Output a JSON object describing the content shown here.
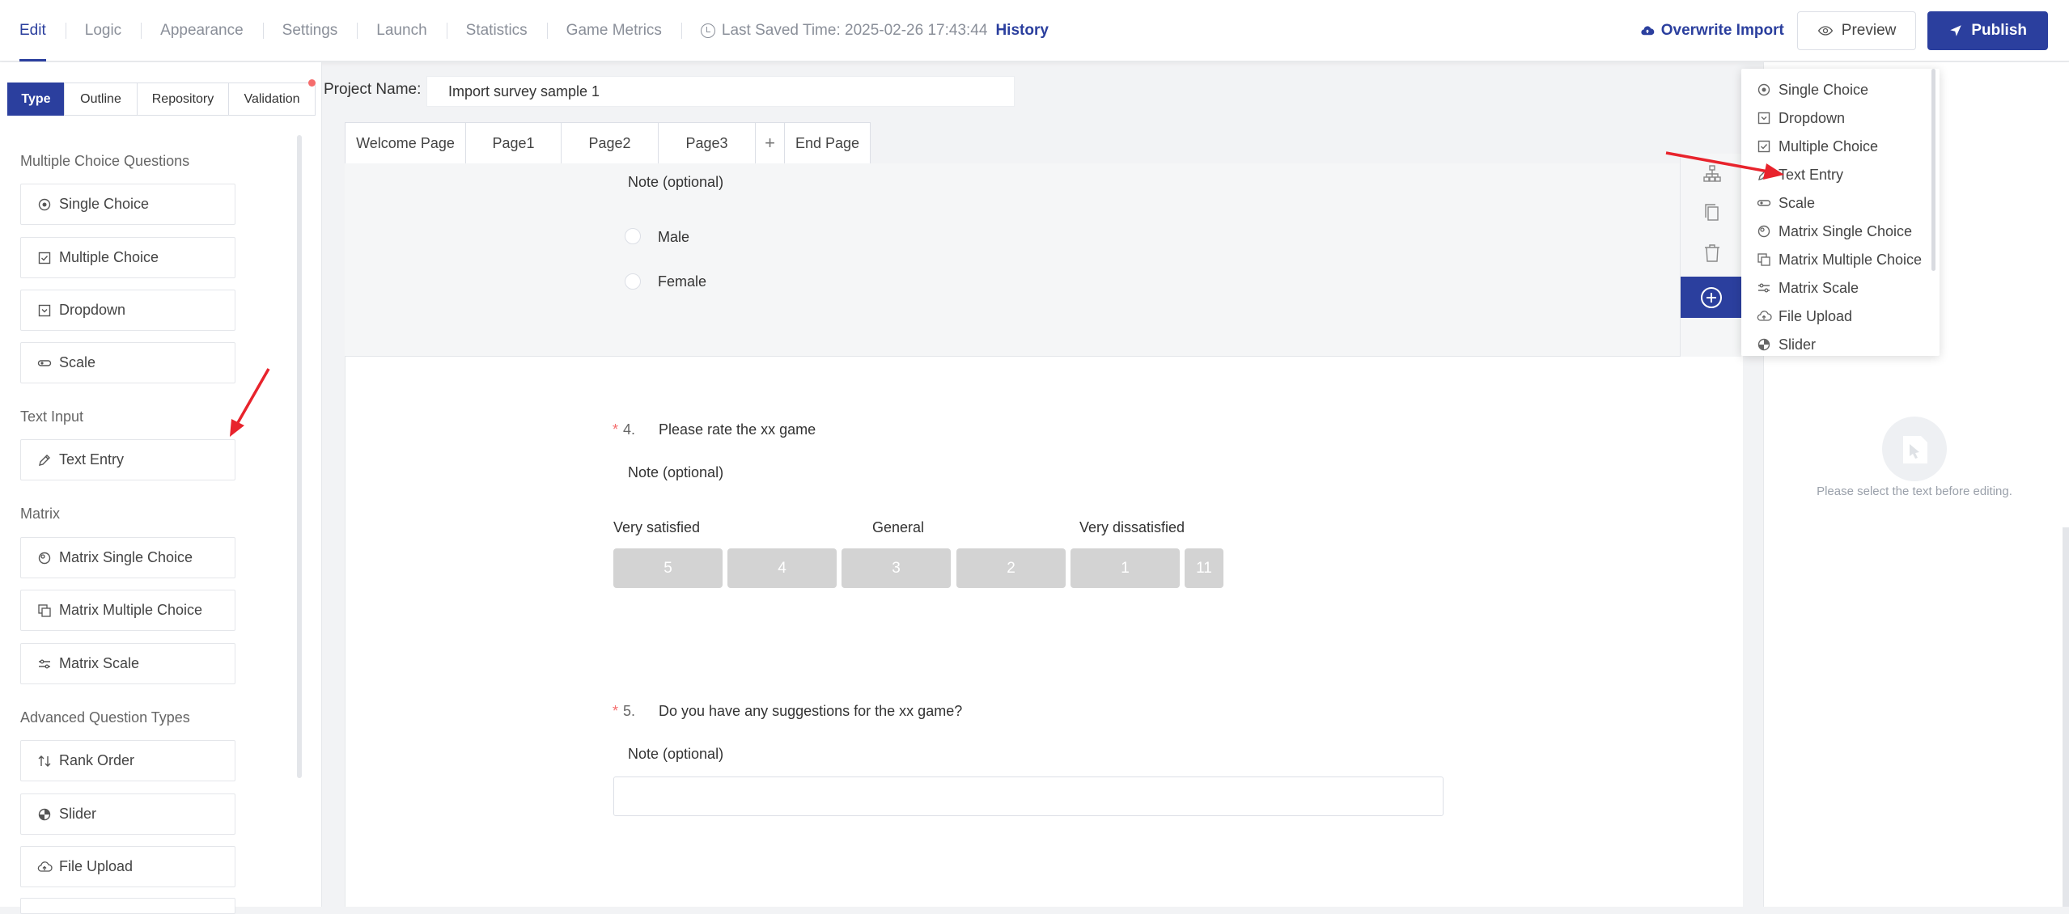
{
  "topnav": {
    "items": [
      "Edit",
      "Logic",
      "Appearance",
      "Settings",
      "Launch",
      "Statistics",
      "Game Metrics"
    ],
    "saved_text": "Last Saved Time: 2025-02-26 17:43:44",
    "history_label": "History"
  },
  "actions": {
    "overwrite_label": "Overwrite Import",
    "preview_label": "Preview",
    "publish_label": "Publish"
  },
  "left_tabs": [
    "Type",
    "Outline",
    "Repository",
    "Validation"
  ],
  "groups": {
    "multiple_choice": {
      "title": "Multiple Choice Questions",
      "items": [
        {
          "label": "Single Choice",
          "icon": "single-choice-icon"
        },
        {
          "label": "Multiple Choice",
          "icon": "checkbox-icon"
        },
        {
          "label": "Dropdown",
          "icon": "dropdown-icon"
        },
        {
          "label": "Scale",
          "icon": "scale-icon"
        }
      ]
    },
    "text_input": {
      "title": "Text Input",
      "items": [
        {
          "label": "Text Entry",
          "icon": "pencil-icon"
        }
      ]
    },
    "matrix": {
      "title": "Matrix",
      "items": [
        {
          "label": "Matrix Single Choice",
          "icon": "matrix-single-icon"
        },
        {
          "label": "Matrix Multiple Choice",
          "icon": "matrix-multiple-icon"
        },
        {
          "label": "Matrix Scale",
          "icon": "matrix-scale-icon"
        }
      ]
    },
    "advanced": {
      "title": "Advanced Question Types",
      "items": [
        {
          "label": "Rank Order",
          "icon": "rank-order-icon"
        },
        {
          "label": "Slider",
          "icon": "slider-icon"
        },
        {
          "label": "File Upload",
          "icon": "cloud-upload-icon"
        }
      ]
    }
  },
  "project": {
    "label": "Project Name:",
    "value": "Import survey sample 1"
  },
  "page_tabs": [
    "Welcome Page",
    "Page1",
    "Page2",
    "Page3",
    "+",
    "End Page"
  ],
  "q3": {
    "note": "Note (optional)",
    "options": [
      "Male",
      "Female"
    ]
  },
  "q4": {
    "number": "4.",
    "required_mark": "*",
    "text": "Please rate the xx game",
    "note": "Note (optional)",
    "scale_labels": [
      "Very satisfied",
      "General",
      "Very dissatisfied"
    ],
    "scale_values": [
      "5",
      "4",
      "3",
      "2",
      "1",
      "11"
    ]
  },
  "q5": {
    "number": "5.",
    "required_mark": "*",
    "text": "Do you have any suggestions for the xx game?",
    "note": "Note (optional)"
  },
  "dropdown": {
    "items": [
      {
        "label": "Single Choice",
        "icon": "single-choice-icon"
      },
      {
        "label": "Dropdown",
        "icon": "dropdown-icon"
      },
      {
        "label": "Multiple Choice",
        "icon": "checkbox-icon"
      },
      {
        "label": "Text Entry",
        "icon": "pencil-icon"
      },
      {
        "label": "Scale",
        "icon": "scale-icon"
      },
      {
        "label": "Matrix Single Choice",
        "icon": "matrix-single-icon"
      },
      {
        "label": "Matrix Multiple Choice",
        "icon": "matrix-multiple-icon"
      },
      {
        "label": "Matrix Scale",
        "icon": "matrix-scale-icon"
      },
      {
        "label": "File Upload",
        "icon": "cloud-upload-icon"
      },
      {
        "label": "Slider",
        "icon": "slider-icon"
      }
    ]
  },
  "right_panel": {
    "empty_text": "Please select the text before editing."
  },
  "colors": {
    "brand": "#2b3f9e",
    "annotation_arrow": "#e8232c",
    "required": "#f56c6c",
    "scale_button": "#d3d3d3"
  }
}
